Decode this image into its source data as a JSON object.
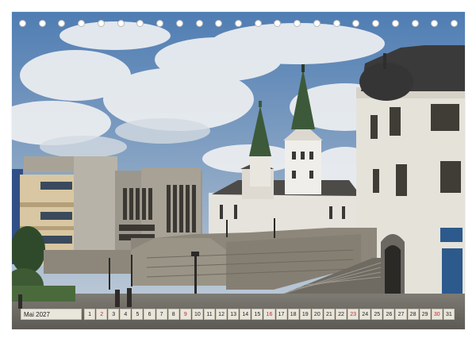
{
  "calendar": {
    "month_label": "Mai 2027",
    "days": [
      {
        "n": "1",
        "sun": false
      },
      {
        "n": "2",
        "sun": true
      },
      {
        "n": "3",
        "sun": false
      },
      {
        "n": "4",
        "sun": false
      },
      {
        "n": "5",
        "sun": false
      },
      {
        "n": "6",
        "sun": false
      },
      {
        "n": "7",
        "sun": false
      },
      {
        "n": "8",
        "sun": false
      },
      {
        "n": "9",
        "sun": true
      },
      {
        "n": "10",
        "sun": false
      },
      {
        "n": "11",
        "sun": false
      },
      {
        "n": "12",
        "sun": false
      },
      {
        "n": "13",
        "sun": false
      },
      {
        "n": "14",
        "sun": false
      },
      {
        "n": "15",
        "sun": false
      },
      {
        "n": "16",
        "sun": true
      },
      {
        "n": "17",
        "sun": false
      },
      {
        "n": "18",
        "sun": false
      },
      {
        "n": "19",
        "sun": false
      },
      {
        "n": "20",
        "sun": false
      },
      {
        "n": "21",
        "sun": false
      },
      {
        "n": "22",
        "sun": false
      },
      {
        "n": "23",
        "sun": true
      },
      {
        "n": "24",
        "sun": false
      },
      {
        "n": "25",
        "sun": false
      },
      {
        "n": "26",
        "sun": false
      },
      {
        "n": "27",
        "sun": false
      },
      {
        "n": "28",
        "sun": false
      },
      {
        "n": "29",
        "sun": false
      },
      {
        "n": "30",
        "sun": true
      },
      {
        "n": "31",
        "sun": false
      }
    ],
    "ring_count": 23
  },
  "colors": {
    "sunday": "#c0282d",
    "cell_bg": "#e9e6dc",
    "sky": "#5f86b6",
    "spire": "#3c5a3a"
  }
}
